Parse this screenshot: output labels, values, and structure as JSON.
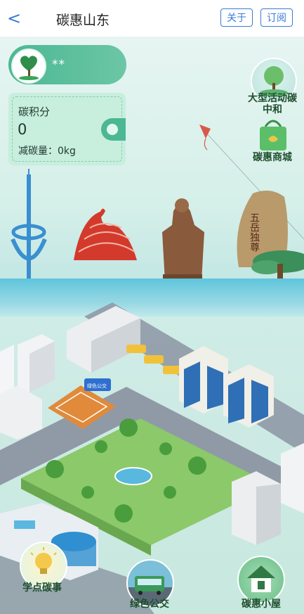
{
  "header": {
    "back_glyph": "<",
    "title": "碳惠山东",
    "about_label": "关于",
    "subscribe_label": "订阅"
  },
  "user": {
    "name": "**"
  },
  "carbon": {
    "label": "碳积分",
    "value": "0",
    "reduced": "减碳量：0kg"
  },
  "side": {
    "event_label": "大型活动碳中和",
    "shop_label": "碳惠商城"
  },
  "bottom": {
    "learn_label": "学点碳事",
    "bus_label": "绿色公交",
    "house_label": "碳惠小屋"
  },
  "scene": {
    "rock_text": "五岳独尊",
    "bus_sign": "绿色公交"
  },
  "colors": {
    "accent_blue": "#3a7bd5",
    "accent_green": "#4bb893",
    "badge_text": "#1f4f2e"
  }
}
